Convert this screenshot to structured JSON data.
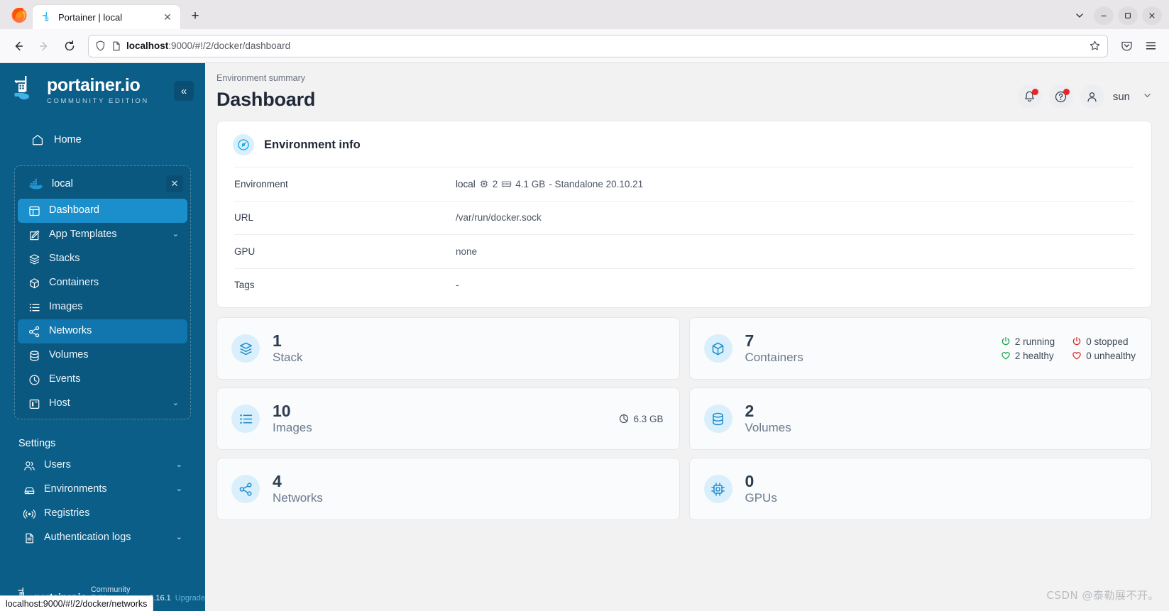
{
  "browser": {
    "tab": {
      "title": "Portainer | local",
      "favicon": "portainer-favicon",
      "close_label": "✕"
    },
    "newtab_label": "+",
    "window": {
      "chevron": "⌵",
      "minimize": "—",
      "maximize": "❐",
      "close": "✕"
    },
    "nav": {
      "back": "←",
      "forward": "→",
      "reload": "⟳"
    },
    "url": {
      "host": "localhost",
      "rest": ":9000/#!/2/docker/dashboard",
      "full": "localhost:9000/#!/2/docker/dashboard"
    },
    "statusbar": "localhost:9000/#!/2/docker/networks"
  },
  "sidebar": {
    "brand": {
      "name": "portainer.io",
      "edition": "COMMUNITY EDITION"
    },
    "collapse_label": "«",
    "home": {
      "label": "Home",
      "icon": "home-icon"
    },
    "environment": {
      "label": "local",
      "icon": "docker-icon",
      "close_label": "✕"
    },
    "items": [
      {
        "label": "Dashboard",
        "icon": "dashboard-icon",
        "state": "active",
        "chevron": ""
      },
      {
        "label": "App Templates",
        "icon": "template-icon",
        "state": "",
        "chevron": "⌄"
      },
      {
        "label": "Stacks",
        "icon": "stacks-icon",
        "state": "",
        "chevron": ""
      },
      {
        "label": "Containers",
        "icon": "containers-icon",
        "state": "",
        "chevron": ""
      },
      {
        "label": "Images",
        "icon": "images-icon",
        "state": "",
        "chevron": ""
      },
      {
        "label": "Networks",
        "icon": "networks-icon",
        "state": "hover",
        "chevron": ""
      },
      {
        "label": "Volumes",
        "icon": "volumes-icon",
        "state": "",
        "chevron": ""
      },
      {
        "label": "Events",
        "icon": "events-icon",
        "state": "",
        "chevron": ""
      },
      {
        "label": "Host",
        "icon": "host-icon",
        "state": "",
        "chevron": "⌄"
      }
    ],
    "settings_title": "Settings",
    "settings_items": [
      {
        "label": "Users",
        "icon": "users-icon",
        "chevron": "⌄"
      },
      {
        "label": "Environments",
        "icon": "environments-icon",
        "chevron": "⌄"
      },
      {
        "label": "Registries",
        "icon": "registries-icon",
        "chevron": ""
      },
      {
        "label": "Authentication logs",
        "icon": "auth-logs-icon",
        "chevron": "⌄"
      }
    ],
    "footer": {
      "brand": "portainer.io",
      "edition": "Community Edition",
      "version": "2.16.1",
      "upgrade": "Upgrade"
    }
  },
  "header": {
    "breadcrumb": "Environment summary",
    "title": "Dashboard",
    "notifications_icon": "bell-icon",
    "help_icon": "help-icon",
    "user_icon": "user-icon",
    "user_name": "sun",
    "user_chevron": "⌄"
  },
  "environment_info": {
    "card_title": "Environment info",
    "card_icon": "gauge-icon",
    "rows": [
      {
        "key": "Environment",
        "value": "local",
        "cpu": "2",
        "memory": "4.1 GB",
        "suffix": "- Standalone 20.10.21"
      },
      {
        "key": "URL",
        "value": "/var/run/docker.sock"
      },
      {
        "key": "GPU",
        "value": "none"
      },
      {
        "key": "Tags",
        "value": "-"
      }
    ]
  },
  "stats": [
    {
      "count": "1",
      "label": "Stack",
      "icon": "stacks-icon"
    },
    {
      "count": "7",
      "label": "Containers",
      "icon": "containers-icon",
      "statuses": [
        {
          "text": "2 running",
          "icon": "power-icon",
          "tone": "green"
        },
        {
          "text": "0 stopped",
          "icon": "power-icon",
          "tone": "red"
        },
        {
          "text": "2 healthy",
          "icon": "heart-icon",
          "tone": "green"
        },
        {
          "text": "0 unhealthy",
          "icon": "heart-icon",
          "tone": "red"
        }
      ]
    },
    {
      "count": "10",
      "label": "Images",
      "icon": "images-icon",
      "size": "6.3 GB",
      "size_icon": "pie-icon"
    },
    {
      "count": "2",
      "label": "Volumes",
      "icon": "volumes-icon"
    },
    {
      "count": "4",
      "label": "Networks",
      "icon": "networks-icon"
    },
    {
      "count": "0",
      "label": "GPUs",
      "icon": "gpu-icon"
    }
  ],
  "watermark": "CSDN @泰勒展不开。",
  "colors": {
    "sidebar_bg": "#0b5e88",
    "sidebar_active": "#1b8fcc",
    "accent": "#1e8ecb",
    "green": "#16a34a",
    "red": "#dc2626",
    "badge": "#ef2222"
  }
}
